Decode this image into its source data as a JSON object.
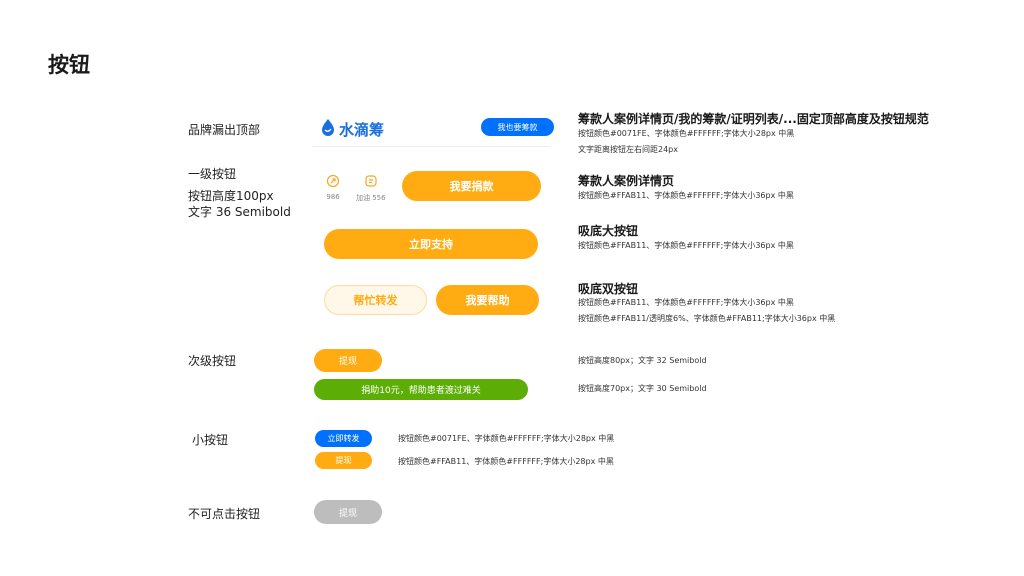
{
  "page": {
    "title": "按钮"
  },
  "rows": {
    "brand_top": {
      "label": "品牌漏出顶部"
    },
    "primary": {
      "label": "一级按钮",
      "sub1": "按钮高度100px",
      "sub2": "文字 36 Semibold"
    },
    "secondary": {
      "label": "次级按钮"
    },
    "small": {
      "label": "小按钮"
    },
    "disabled": {
      "label": "不可点击按钮"
    }
  },
  "brand": {
    "name": "水滴筹",
    "cta": "我也要筹款"
  },
  "primary_demo": {
    "share_count": "986",
    "cheer_label": "加油 556",
    "donate_button": "我要捐款",
    "support_button": "立即支持",
    "forward_button": "帮忙转发",
    "help_button": "我要帮助"
  },
  "secondary_demo": {
    "withdraw_button": "提现",
    "donate_green_button": "捐助10元，帮助患者渡过难关"
  },
  "small_demo": {
    "support_small_button": "立即转发",
    "withdraw_small_button": "提现"
  },
  "disabled_demo": {
    "withdraw_disabled_button": "提现"
  },
  "descriptions": {
    "brand_title": "筹款人案例详情页/我的筹款/证明列表/...固定顶部高度及按钮规范",
    "brand_spec1": "按钮颜色#0071FE、字体颜色#FFFFFF;字体大小28px 中黑",
    "brand_spec2": "文字距离按钮左右间距24px",
    "case_title": "筹款人案例详情页",
    "case_spec": "按钮颜色#FFAB11、字体颜色#FFFFFF;字体大小36px 中黑",
    "bottom_big_title": "吸底大按钮",
    "bottom_big_spec": "按钮颜色#FFAB11、字体颜色#FFFFFF;字体大小36px 中黑",
    "bottom_double_title": "吸底双按钮",
    "bottom_double_spec1": "按钮颜色#FFAB11、字体颜色#FFFFFF;字体大小36px 中黑",
    "bottom_double_spec2": "按钮颜色#FFAB11/透明度6%、字体颜色#FFAB11;字体大小36px 中黑",
    "secondary_spec1": "按钮高度80px；文字 32 Semibold",
    "secondary_spec2": "按钮高度70px；文字 30 Semibold",
    "small_spec1": "按钮颜色#0071FE、字体颜色#FFFFFF;字体大小28px 中黑",
    "small_spec2": "按钮颜色#FFAB11、字体颜色#FFFFFF;字体大小28px 中黑"
  },
  "colors": {
    "blue": "#0071FE",
    "orange": "#FFAB11",
    "green": "#5CAE07",
    "disabled": "#BDBDBD"
  },
  "icons": {
    "logo": "water-drop-icon",
    "share": "share-icon",
    "cheer": "cheer-icon"
  }
}
